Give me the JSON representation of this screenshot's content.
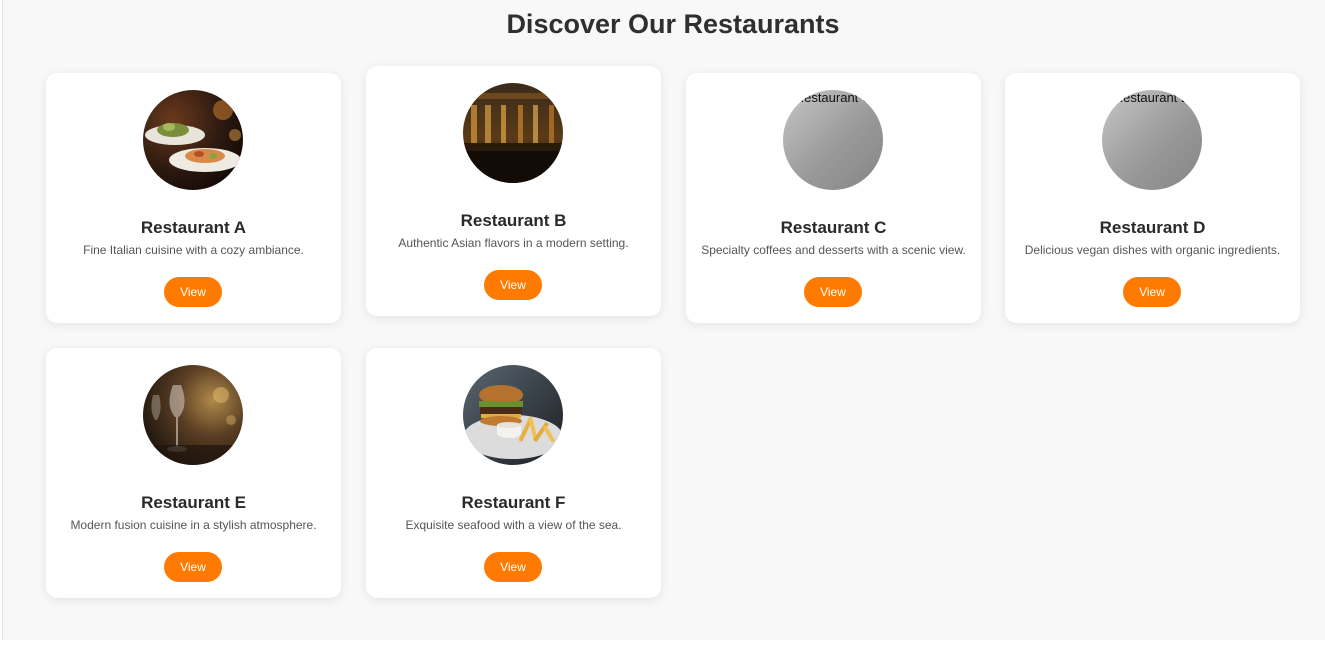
{
  "page": {
    "title": "Discover Our Restaurants"
  },
  "colors": {
    "accent": "#ff7a00",
    "page_background": "#f8f8f8",
    "card_background": "#ffffff"
  },
  "restaurants": [
    {
      "name": "Restaurant A",
      "description": "Fine Italian cuisine with a cozy ambiance.",
      "button_label": "View",
      "image": "plated-food-photo"
    },
    {
      "name": "Restaurant B",
      "description": "Authentic Asian flavors in a modern setting.",
      "button_label": "View",
      "image": "bar-interior-photo"
    },
    {
      "name": "Restaurant C",
      "description": "Specialty coffees and desserts with a scenic view.",
      "button_label": "View",
      "image": "broken-image",
      "image_alt": "Restaurant C"
    },
    {
      "name": "Restaurant D",
      "description": "Delicious vegan dishes with organic ingredients.",
      "button_label": "View",
      "image": "broken-image",
      "image_alt": "Restaurant D"
    },
    {
      "name": "Restaurant E",
      "description": "Modern fusion cuisine in a stylish atmosphere.",
      "button_label": "View",
      "image": "wine-glass-photo"
    },
    {
      "name": "Restaurant F",
      "description": "Exquisite seafood with a view of the sea.",
      "button_label": "View",
      "image": "burger-fries-photo"
    }
  ]
}
